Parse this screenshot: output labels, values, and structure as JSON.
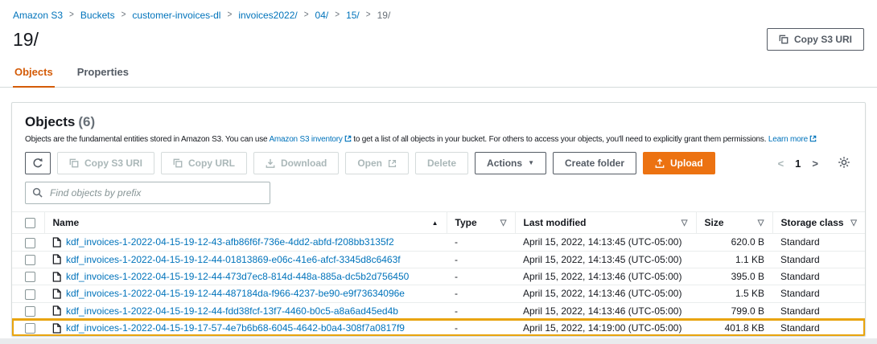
{
  "colors": {
    "link_blue": "#0073bb",
    "primary_orange": "#ec7211",
    "active_tab_orange": "#d45b07",
    "annotation_highlight": "#e9a40d",
    "panel_border": "#d5dbdb",
    "text_primary": "#16191f",
    "text_secondary": "#545b64",
    "disabled_text": "#aab7b8"
  },
  "breadcrumb": {
    "separator": ">",
    "items": [
      {
        "label": "Amazon S3"
      },
      {
        "label": "Buckets"
      },
      {
        "label": "customer-invoices-dl"
      },
      {
        "label": "invoices2022/"
      },
      {
        "label": "04/"
      },
      {
        "label": "15/"
      },
      {
        "label": "19/"
      }
    ]
  },
  "header": {
    "title": "19/",
    "copy_s3_uri_button": "Copy S3 URI"
  },
  "tabs": [
    {
      "label": "Objects"
    },
    {
      "label": "Properties"
    }
  ],
  "panel": {
    "title": "Objects",
    "count": "(6)",
    "description": {
      "text_before_link1": "Objects are the fundamental entities stored in Amazon S3. You can use ",
      "link1": "Amazon S3 inventory",
      "text_between_links": " to get a list of all objects in your bucket. For others to access your objects, you'll need to explicitly grant them permissions. ",
      "link2": "Learn more"
    },
    "toolbar": {
      "copy_s3_uri": "Copy S3 URI",
      "copy_url": "Copy URL",
      "download": "Download",
      "open": "Open",
      "delete": "Delete",
      "actions": "Actions",
      "create_folder": "Create folder",
      "upload": "Upload"
    },
    "search_placeholder": "Find objects by prefix",
    "pagination": {
      "current_page": "1"
    }
  },
  "table": {
    "columns": [
      "Name",
      "Type",
      "Last modified",
      "Size",
      "Storage class"
    ],
    "rows": [
      {
        "name": "kdf_invoices-1-2022-04-15-19-12-43-afb86f6f-736e-4dd2-abfd-f208bb3135f2",
        "type": "-",
        "last_modified": "April 15, 2022, 14:13:45 (UTC-05:00)",
        "size": "620.0 B",
        "storage_class": "Standard"
      },
      {
        "name": "kdf_invoices-1-2022-04-15-19-12-44-01813869-e06c-41e6-afcf-3345d8c6463f",
        "type": "-",
        "last_modified": "April 15, 2022, 14:13:45 (UTC-05:00)",
        "size": "1.1 KB",
        "storage_class": "Standard"
      },
      {
        "name": "kdf_invoices-1-2022-04-15-19-12-44-473d7ec8-814d-448a-885a-dc5b2d756450",
        "type": "-",
        "last_modified": "April 15, 2022, 14:13:46 (UTC-05:00)",
        "size": "395.0 B",
        "storage_class": "Standard"
      },
      {
        "name": "kdf_invoices-1-2022-04-15-19-12-44-487184da-f966-4237-be90-e9f73634096e",
        "type": "-",
        "last_modified": "April 15, 2022, 14:13:46 (UTC-05:00)",
        "size": "1.5 KB",
        "storage_class": "Standard"
      },
      {
        "name": "kdf_invoices-1-2022-04-15-19-12-44-fdd38fcf-13f7-4460-b0c5-a8a6ad45ed4b",
        "type": "-",
        "last_modified": "April 15, 2022, 14:13:46 (UTC-05:00)",
        "size": "799.0 B",
        "storage_class": "Standard"
      },
      {
        "name": "kdf_invoices-1-2022-04-15-19-17-57-4e7b6b68-6045-4642-b0a4-308f7a0817f9",
        "type": "-",
        "last_modified": "April 15, 2022, 14:19:00 (UTC-05:00)",
        "size": "401.8 KB",
        "storage_class": "Standard",
        "highlighted": true
      }
    ]
  },
  "glyphs": {
    "sort_ascending": "▲",
    "sort_inactive": "▽",
    "actions_caret": "▼",
    "page_prev": "<",
    "page_next": ">"
  }
}
